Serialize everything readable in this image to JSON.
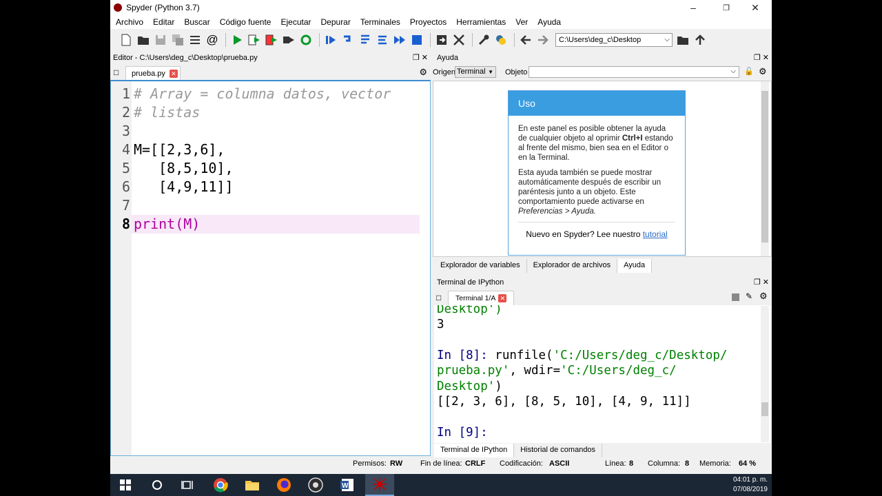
{
  "window": {
    "title": "Spyder (Python 3.7)"
  },
  "menu": [
    "Archivo",
    "Editar",
    "Buscar",
    "Código fuente",
    "Ejecutar",
    "Depurar",
    "Terminales",
    "Proyectos",
    "Herramientas",
    "Ver",
    "Ayuda"
  ],
  "toolbar": {
    "path": "C:\\Users\\deg_c\\Desktop"
  },
  "editor": {
    "title": "Editor - C:\\Users\\deg_c\\Desktop\\prueba.py",
    "tab": "prueba.py",
    "lines": [
      {
        "n": "1",
        "text": "# Array = columna datos, vector"
      },
      {
        "n": "2",
        "text": "# listas"
      },
      {
        "n": "3",
        "text": ""
      },
      {
        "n": "4",
        "text": "M=[[2,3,6],"
      },
      {
        "n": "5",
        "text": "   [8,5,10],"
      },
      {
        "n": "6",
        "text": "   [4,9,11]]"
      },
      {
        "n": "7",
        "text": ""
      },
      {
        "n": "8",
        "text": "print(M)"
      }
    ]
  },
  "help": {
    "title": "Ayuda",
    "source_label": "Origen",
    "source_value": "Terminal",
    "object_label": "Objeto",
    "box_title": "Uso",
    "para1_a": "En este panel es posible obtener la ayuda de cualquier objeto al oprimir ",
    "para1_b": "Ctrl+I",
    "para1_c": " estando al frente del mismo, bien sea en el Editor o en la Terminal.",
    "para2_a": "Esta ayuda también se puede mostrar automáticamente después de escribir un paréntesis junto a un objeto. Este comportamiento puede activarse en ",
    "para2_b": "Preferencias > Ayuda.",
    "foot_text": "Nuevo en Spyder? Lee nuestro ",
    "foot_link": "tutorial",
    "tabs": [
      "Explorador de variables",
      "Explorador de archivos",
      "Ayuda"
    ]
  },
  "console": {
    "title": "Terminal de IPython",
    "tab": "Terminal 1/A",
    "lines": {
      "l1": "Desktop')",
      "l2": "3",
      "l3a": "In [8]: ",
      "l3b": "runfile(",
      "l3c": "'C:/Users/deg_c/Desktop/",
      "l4a": "prueba.py'",
      "l4b": ", wdir=",
      "l4c": "'C:/Users/deg_c/",
      "l5a": "Desktop'",
      "l5b": ")",
      "l6": "[[2, 3, 6], [8, 5, 10], [4, 9, 11]]",
      "l7": "In [9]: "
    },
    "tabs": [
      "Terminal de IPython",
      "Historial de comandos"
    ]
  },
  "status": {
    "perm_label": "Permisos:",
    "perm": "RW",
    "eol_label": "Fin de línea:",
    "eol": "CRLF",
    "enc_label": "Codificación:",
    "enc": "ASCII",
    "line_label": "Línea:",
    "line": "8",
    "col_label": "Columna:",
    "col": "8",
    "mem_label": "Memoria:",
    "mem": "64 %"
  },
  "taskbar": {
    "time": "04:01 p. m.",
    "date": "07/08/2019"
  }
}
